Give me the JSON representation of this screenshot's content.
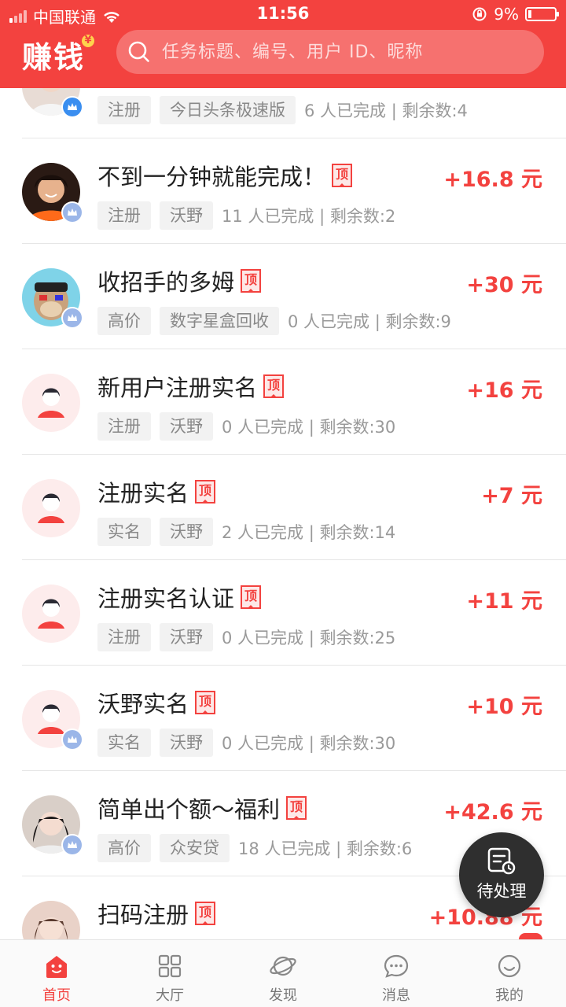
{
  "status_bar": {
    "carrier": "中国联通",
    "time": "11:56",
    "battery": "9%"
  },
  "header": {
    "logo": "赚钱",
    "search_placeholder": "任务标题、编号、用户 ID、昵称"
  },
  "colors": {
    "brand": "#f3423f",
    "tag_bg": "#f2f2f2"
  },
  "tasks": [
    {
      "title": "",
      "pinned": false,
      "reward": "",
      "tags": [
        "注册",
        "今日头条极速版"
      ],
      "stats": "6 人已完成 | 剩余数:4",
      "avatar": "photo-girl",
      "badge": "vip-icon"
    },
    {
      "title": "不到一分钟就能完成！",
      "pinned": true,
      "pin_label": "顶",
      "reward": "+16.8 元",
      "tags": [
        "注册",
        "沃野"
      ],
      "stats": "11 人已完成 | 剩余数:2",
      "avatar": "photo-boy",
      "badge": "crown-icon"
    },
    {
      "title": "收招手的多姆",
      "pinned": true,
      "pin_label": "顶",
      "reward": "+30 元",
      "tags": [
        "高价",
        "数字星盒回收"
      ],
      "stats": "0 人已完成 | 剩余数:9",
      "avatar": "cartoon-ape",
      "badge": "crown-icon"
    },
    {
      "title": "新用户注册实名",
      "pinned": true,
      "pin_label": "顶",
      "reward": "+16 元",
      "tags": [
        "注册",
        "沃野"
      ],
      "stats": "0 人已完成 | 剩余数:30",
      "avatar": "default-user",
      "badge": ""
    },
    {
      "title": "注册实名",
      "pinned": true,
      "pin_label": "顶",
      "reward": "+7 元",
      "tags": [
        "实名",
        "沃野"
      ],
      "stats": "2 人已完成 | 剩余数:14",
      "avatar": "default-user",
      "badge": ""
    },
    {
      "title": "注册实名认证",
      "pinned": true,
      "pin_label": "顶",
      "reward": "+11 元",
      "tags": [
        "注册",
        "沃野"
      ],
      "stats": "0 人已完成 | 剩余数:25",
      "avatar": "default-user",
      "badge": ""
    },
    {
      "title": "沃野实名",
      "pinned": true,
      "pin_label": "顶",
      "reward": "+10 元",
      "tags": [
        "实名",
        "沃野"
      ],
      "stats": "0 人已完成 | 剩余数:30",
      "avatar": "default-user",
      "badge": "crown-icon"
    },
    {
      "title": "简单出个额～福利",
      "pinned": true,
      "pin_label": "顶",
      "reward": "+42.6 元",
      "tags": [
        "高价",
        "众安贷"
      ],
      "stats": "18 人已完成 | 剩余数:6",
      "avatar": "photo-girl",
      "badge": "crown-icon"
    },
    {
      "title": "扫码注册",
      "pinned": true,
      "pin_label": "顶",
      "reward": "+10.88 元",
      "tags": [
        "",
        ""
      ],
      "stats": "",
      "avatar": "photo-girl",
      "badge": ""
    }
  ],
  "fab": {
    "label": "待处理",
    "icon": "pending-tasks-icon"
  },
  "tabbar": [
    {
      "label": "首页",
      "icon": "home-icon",
      "active": true
    },
    {
      "label": "大厅",
      "icon": "grid-icon",
      "active": false
    },
    {
      "label": "发现",
      "icon": "planet-icon",
      "active": false
    },
    {
      "label": "消息",
      "icon": "message-icon",
      "active": false
    },
    {
      "label": "我的",
      "icon": "smile-icon",
      "active": false
    }
  ]
}
